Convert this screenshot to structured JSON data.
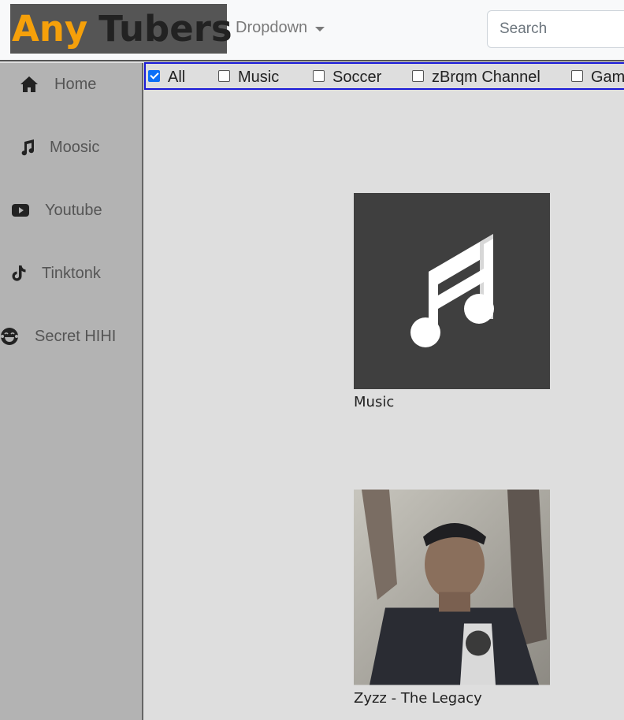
{
  "header": {
    "brand_part1": "Any",
    "brand_part2": "Tubers",
    "dropdown_label": "Dropdown",
    "search_placeholder": "Search"
  },
  "sidebar": {
    "items": [
      {
        "label": "Home",
        "icon": "home-icon"
      },
      {
        "label": "Moosic",
        "icon": "music-note-icon"
      },
      {
        "label": "Youtube",
        "icon": "youtube-icon"
      },
      {
        "label": "Tinktonk",
        "icon": "tiktok-icon"
      },
      {
        "label": "Secret HIHI",
        "icon": "laughing-face-icon"
      }
    ]
  },
  "filters": [
    {
      "label": "All",
      "checked": true
    },
    {
      "label": "Music",
      "checked": false
    },
    {
      "label": "Soccer",
      "checked": false
    },
    {
      "label": "zBrqm Channel",
      "checked": false
    },
    {
      "label": "Gami",
      "checked": false
    }
  ],
  "cards": [
    {
      "caption": "Music"
    },
    {
      "caption": "Zyzz - The Legacy"
    }
  ],
  "colors": {
    "brand_accent": "#f5a00a",
    "filter_border": "#1a1ad6",
    "checkbox_on": "#0b6ff7"
  }
}
